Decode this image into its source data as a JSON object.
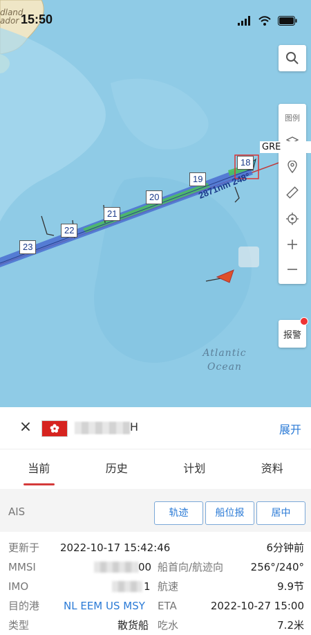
{
  "status_bar": {
    "time": "15:50"
  },
  "map": {
    "corner_land_label": "dland\nador",
    "ocean_label": "Atlantic\nOcean",
    "ship_name_tag": "GRE",
    "track_distance_label": "2871nm 248°",
    "day_markers": [
      "23",
      "22",
      "21",
      "20",
      "19",
      "18"
    ],
    "legend_label": "图例",
    "alarm_label": "报警"
  },
  "ship": {
    "name_suffix": "H",
    "expand_label": "展开"
  },
  "tabs": [
    "当前",
    "历史",
    "计划",
    "资料"
  ],
  "ais": {
    "label": "AIS",
    "buttons": [
      "轨迹",
      "船位报",
      "居中"
    ]
  },
  "details": {
    "updated_label": "更新于",
    "updated_value": "2022-10-17 15:42:46",
    "updated_ago": "6分钟前",
    "mmsi_label": "MMSI",
    "mmsi_value_suffix": "00",
    "heading_label": "船首向/航迹向",
    "heading_value": "256°/240°",
    "imo_label": "IMO",
    "imo_value_suffix": "1",
    "speed_label": "航速",
    "speed_value": "9.9节",
    "dest_label": "目的港",
    "dest_value": "NL EEM US MSY",
    "eta_label": "ETA",
    "eta_value": "2022-10-27 15:00",
    "type_label": "类型",
    "type_value": "散货船",
    "draft_label": "吃水",
    "draft_value": "7.2米"
  },
  "colors": {
    "accent_blue": "#2a7ad6",
    "tab_underline": "#d43a3a",
    "track_blue": "#4a6fd0",
    "track_green": "#4cc15b",
    "ship_marker": "#e0502a",
    "flag_red": "#d6231f"
  }
}
